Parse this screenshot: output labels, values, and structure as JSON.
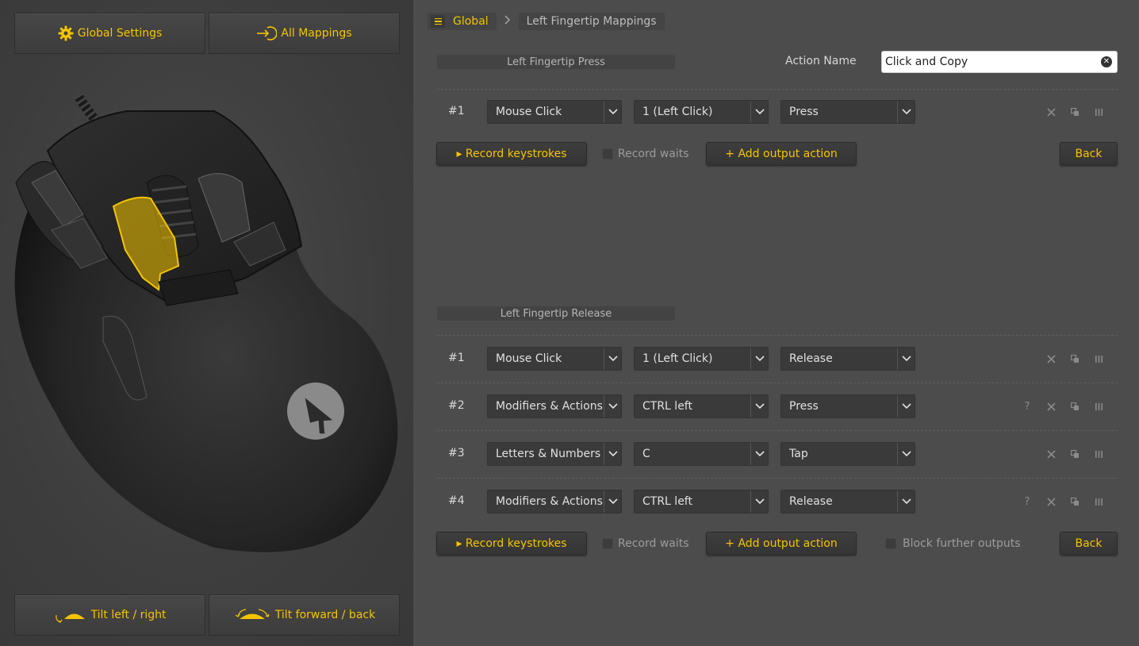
{
  "left_panel": {
    "global_settings_label": "Global Settings",
    "all_mappings_label": "All Mappings",
    "tilt_left_right_label": "Tilt left / right",
    "tilt_forward_back_label": "Tilt forward / back"
  },
  "breadcrumb": {
    "root": "Global",
    "current": "Left Fingertip Mappings"
  },
  "action_name": {
    "label": "Action Name",
    "value": "Click and Copy"
  },
  "press_section": {
    "title": "Left Fingertip Press",
    "rows": [
      {
        "num": "#1",
        "type": "Mouse Click",
        "key": "1 (Left Click)",
        "mode": "Press",
        "has_help": false
      }
    ],
    "record_label": "▸ Record keystrokes",
    "record_waits_label": "Record waits",
    "add_output_label": "+ Add output action",
    "back_label": "Back"
  },
  "release_section": {
    "title": "Left Fingertip Release",
    "rows": [
      {
        "num": "#1",
        "type": "Mouse Click",
        "key": "1 (Left Click)",
        "mode": "Release",
        "has_help": false
      },
      {
        "num": "#2",
        "type": "Modifiers & Actions",
        "key": "CTRL left",
        "mode": "Press",
        "has_help": true
      },
      {
        "num": "#3",
        "type": "Letters & Numbers",
        "key": "C",
        "mode": "Tap",
        "has_help": false
      },
      {
        "num": "#4",
        "type": "Modifiers & Actions",
        "key": "CTRL left",
        "mode": "Release",
        "has_help": true
      }
    ],
    "record_label": "▸ Record keystrokes",
    "record_waits_label": "Record waits",
    "add_output_label": "+ Add output action",
    "block_label": "Block further outputs",
    "back_label": "Back"
  },
  "colors": {
    "accent": "#f5c400",
    "panel_left": "#3d3d3d",
    "panel_right": "#4c4c4c"
  },
  "icons": {
    "help": "?",
    "delete": "✕",
    "copy": "copy-icon",
    "drag": "drag-handle-icon"
  }
}
